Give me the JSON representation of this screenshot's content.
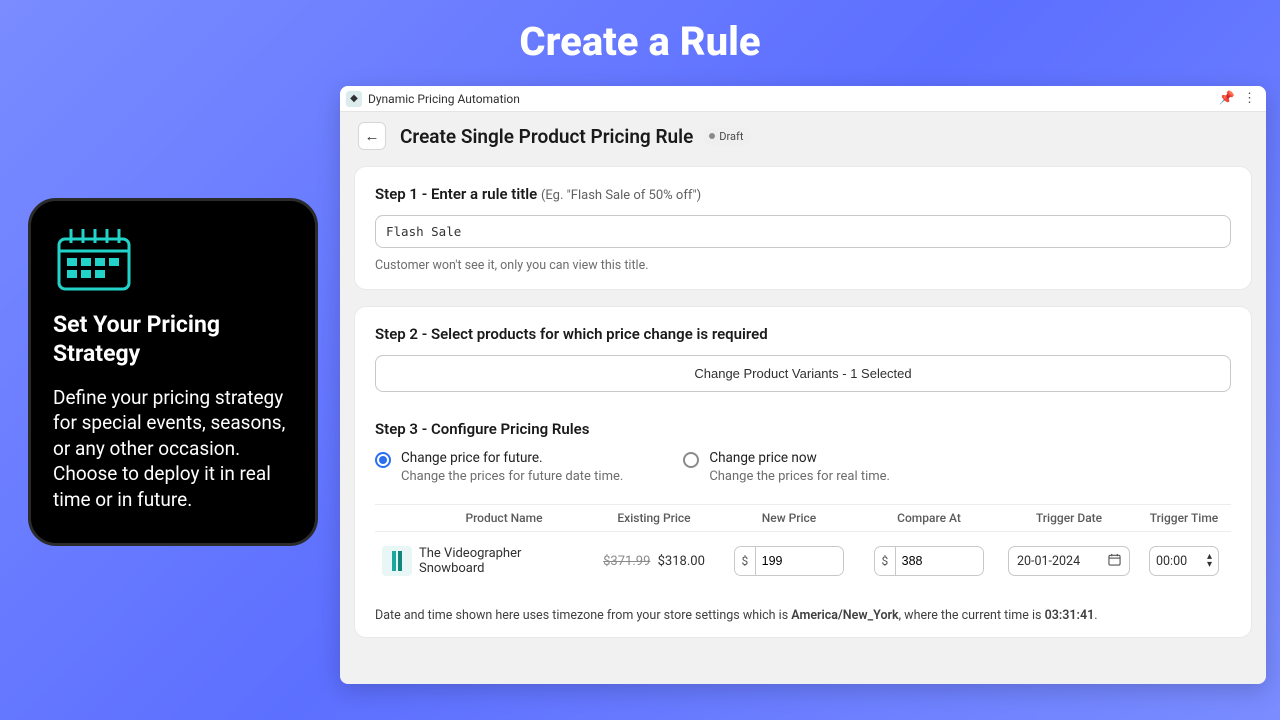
{
  "page_title": "Create a Rule",
  "promo": {
    "title": "Set Your Pricing Strategy",
    "body": "Define your pricing strategy for special events, seasons, or any other occasion. Choose to deploy it in real time or in future."
  },
  "app": {
    "title": "Dynamic Pricing Automation",
    "pin_icon": "📌",
    "menu_icon": "⋮",
    "header": {
      "back_icon": "←",
      "title": "Create Single Product Pricing Rule",
      "status_badge": "Draft"
    },
    "step1": {
      "title": "Step 1 - Enter a rule title",
      "hint": "(Eg. \"Flash Sale of 50% off\")",
      "value": "Flash Sale",
      "helper": "Customer won't see it, only you can view this title."
    },
    "step2": {
      "title": "Step 2 - Select products for which price change is required",
      "button_label": "Change Product Variants - 1 Selected"
    },
    "step3": {
      "title": "Step 3 - Configure Pricing Rules",
      "options": [
        {
          "label": "Change price for future.",
          "desc": "Change the prices for future date time.",
          "checked": true
        },
        {
          "label": "Change price now",
          "desc": "Change the prices for real time.",
          "checked": false
        }
      ],
      "table": {
        "headers": {
          "product_name": "Product Name",
          "existing_price": "Existing Price",
          "new_price": "New Price",
          "compare_at": "Compare At",
          "trigger_date": "Trigger Date",
          "trigger_time": "Trigger Time"
        },
        "row": {
          "product_name": "The Videographer Snowboard",
          "existing_old": "$371.99",
          "existing_new": "$318.00",
          "currency": "$",
          "new_price": "199",
          "compare_at": "388",
          "trigger_date": "20-01-2024",
          "calendar_icon": "📅",
          "trigger_time": "00:00",
          "time_spinner_icon": "⇵"
        }
      },
      "tz_note_prefix": "Date and time shown here uses timezone from your store settings which is ",
      "tz_name": "America/New_York",
      "tz_note_mid": ", where the current time is ",
      "current_time": "03:31:41",
      "tz_note_suffix": "."
    }
  }
}
